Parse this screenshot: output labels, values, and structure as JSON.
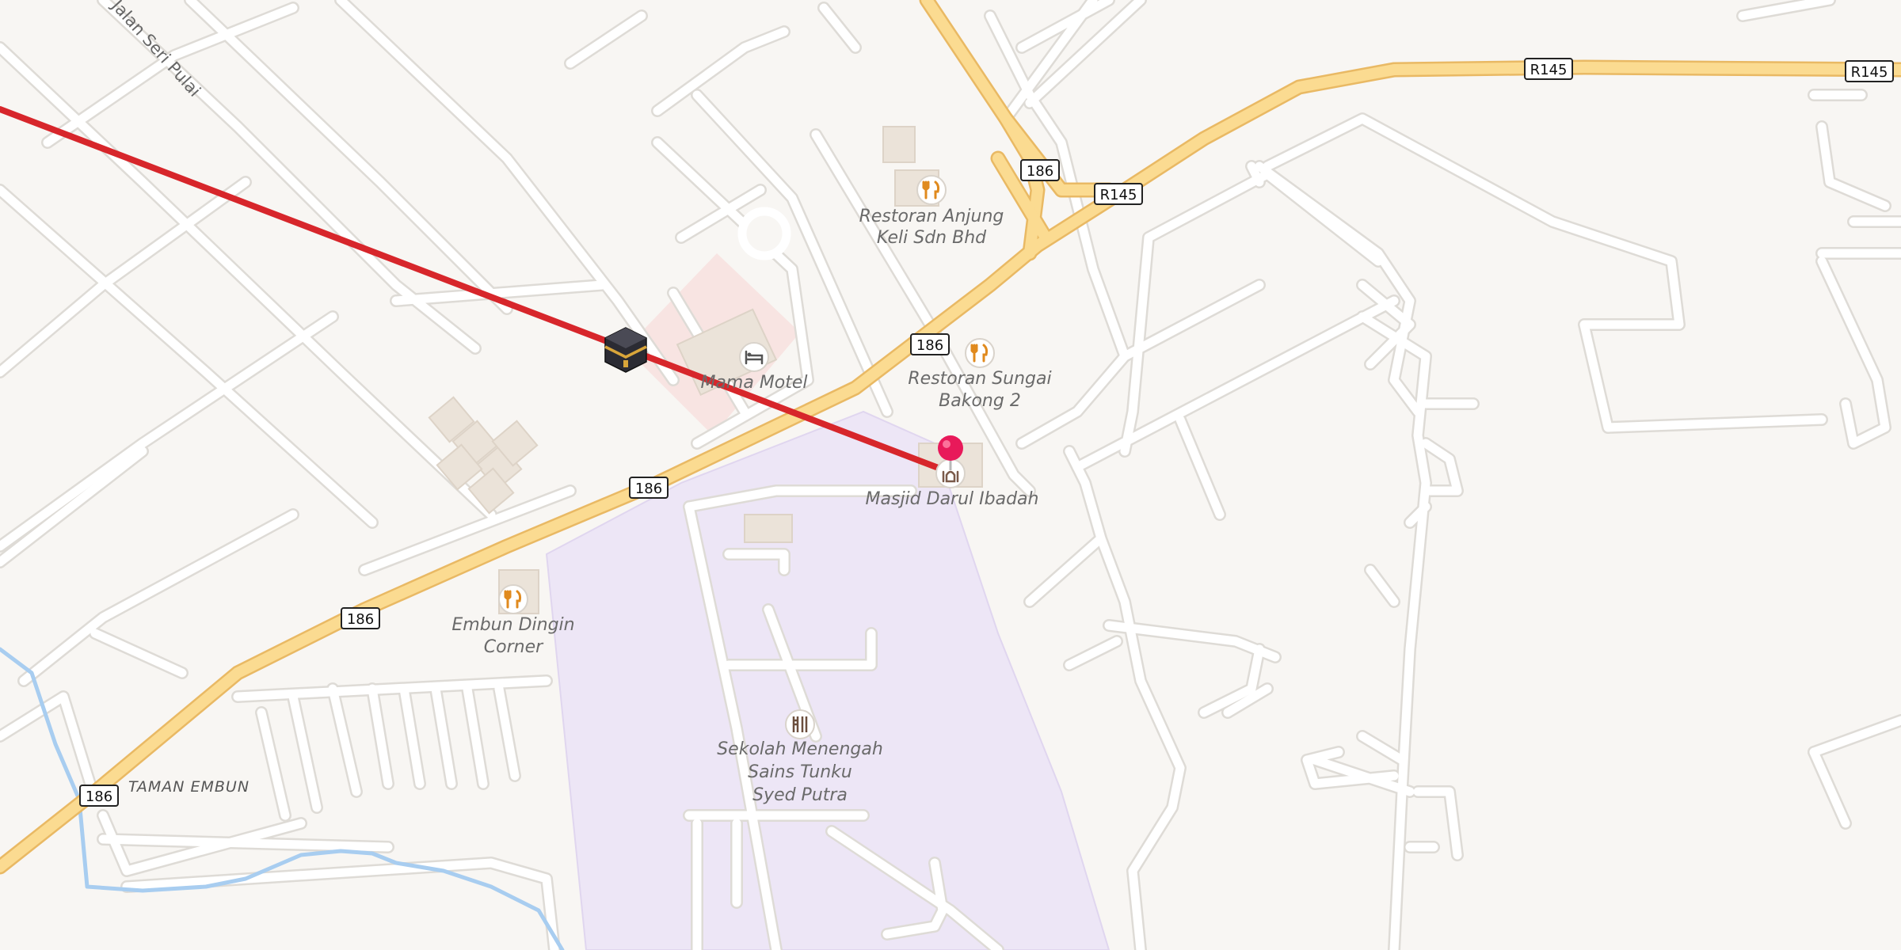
{
  "map": {
    "colors": {
      "background": "#f8f6f3",
      "minor_road": "#ffffff",
      "minor_road_casing": "#dedbd6",
      "major_road": "#fbdb91",
      "major_road_casing": "#e9b964",
      "school_area": "#ede6f6",
      "water": "#a8cdf0",
      "building": "#ebe3d9",
      "qibla_line": "#d7262b",
      "pin": "#e8195a"
    },
    "route_shields": [
      "186",
      "186",
      "186",
      "186",
      "186",
      "186",
      "R145",
      "R145"
    ],
    "pois": [
      {
        "name": "Restoran Anjung",
        "name2": "Keli Sdn Bhd",
        "icon": "restaurant-icon"
      },
      {
        "name": "Mama Motel",
        "icon": "hotel-icon"
      },
      {
        "name": "Restoran Sungai",
        "name2": "Bakong 2",
        "icon": "restaurant-icon"
      },
      {
        "name": "Masjid Darul Ibadah",
        "icon": "mosque-icon"
      },
      {
        "name": "Embun Dingin",
        "name2": "Corner",
        "icon": "restaurant-icon"
      },
      {
        "name": "Sekolah Menengah",
        "name2": "Sains Tunku",
        "name3": "Syed Putra",
        "icon": "school-icon"
      }
    ],
    "street_name": "Jalan Seri Pulai",
    "area_name": "TAMAN EMBUN",
    "markers": {
      "kaaba": "kaaba-icon",
      "location": "location-pin-icon"
    }
  }
}
